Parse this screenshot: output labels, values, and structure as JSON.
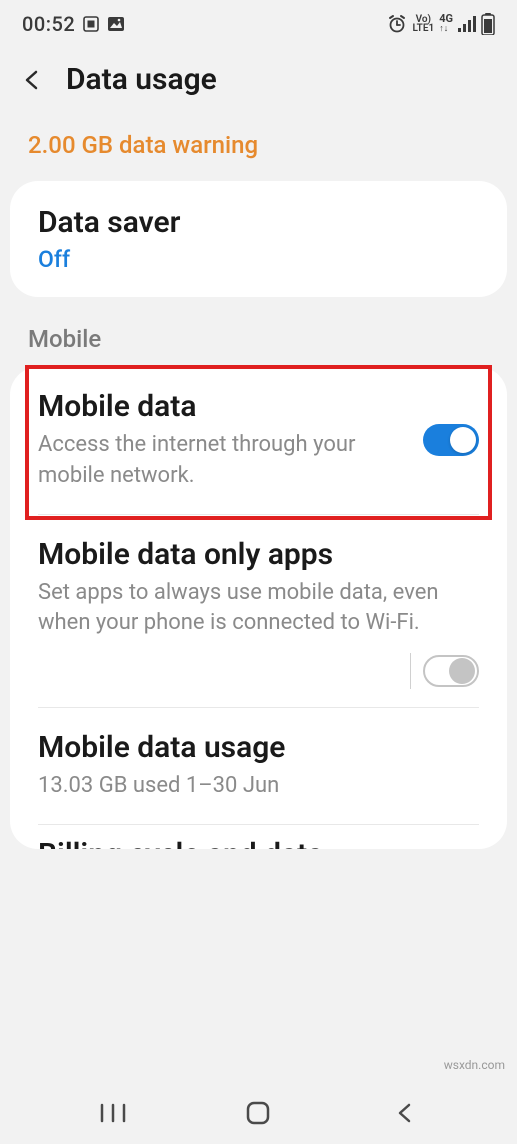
{
  "statusbar": {
    "time": "00:52",
    "network_label_top": "Vo)",
    "network_label_bottom": "LTE1",
    "network_gen": "4G"
  },
  "header": {
    "title": "Data usage"
  },
  "warning": "2.00 GB data warning",
  "data_saver": {
    "title": "Data saver",
    "status": "Off"
  },
  "section_mobile": "Mobile",
  "mobile_data": {
    "title": "Mobile data",
    "desc": "Access the internet through your mobile network.",
    "enabled": true
  },
  "mobile_data_only_apps": {
    "title": "Mobile data only apps",
    "desc": "Set apps to always use mobile data, even when your phone is connected to Wi-Fi.",
    "enabled": false
  },
  "mobile_data_usage": {
    "title": "Mobile data usage",
    "desc": "13.03 GB used 1–30 Jun"
  },
  "cutoff": {
    "title": "Billing cycle and data"
  },
  "watermark": "wsxdn.com"
}
